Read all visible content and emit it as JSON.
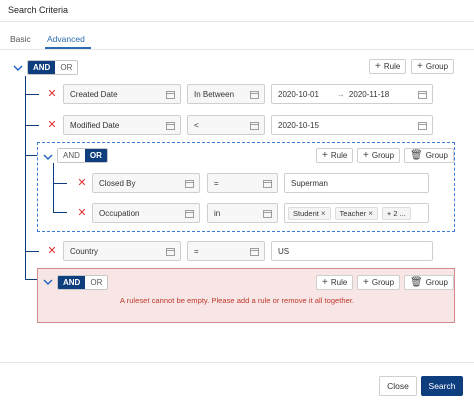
{
  "dialog": {
    "title": "Search Criteria"
  },
  "tabs": [
    {
      "label": "Basic"
    },
    {
      "label": "Advanced"
    }
  ],
  "root": {
    "and": "AND",
    "or": "OR",
    "add_rule": "Rule",
    "add_group": "Group"
  },
  "rules": [
    {
      "field": "Created Date",
      "operator": "In Between",
      "value_from": "2020-10-01",
      "value_to": "2020-11-18"
    },
    {
      "field": "Modified Date",
      "operator": "<",
      "value": "2020-10-15"
    }
  ],
  "group1": {
    "and": "AND",
    "or": "OR",
    "add_rule": "Rule",
    "add_group": "Group",
    "delete_group": "Group",
    "rules": [
      {
        "field": "Closed By",
        "operator": "=",
        "value": "Superman"
      },
      {
        "field": "Occupation",
        "operator": "in",
        "chips": [
          "Student",
          "Teacher"
        ],
        "more": "+ 2 ..."
      }
    ]
  },
  "rule_country": {
    "field": "Country",
    "operator": "=",
    "value": "US"
  },
  "group2": {
    "and": "AND",
    "or": "OR",
    "add_rule": "Rule",
    "add_group": "Group",
    "delete_group": "Group",
    "error": "A ruleset cannot be empty. Please add a rule or remove it all together."
  },
  "footer": {
    "close": "Close",
    "search": "Search"
  },
  "colors": {
    "primary": "#0f3e7f",
    "accent": "#2b6cb0",
    "danger": "#d33333",
    "error_bg": "#f8e6e6"
  }
}
